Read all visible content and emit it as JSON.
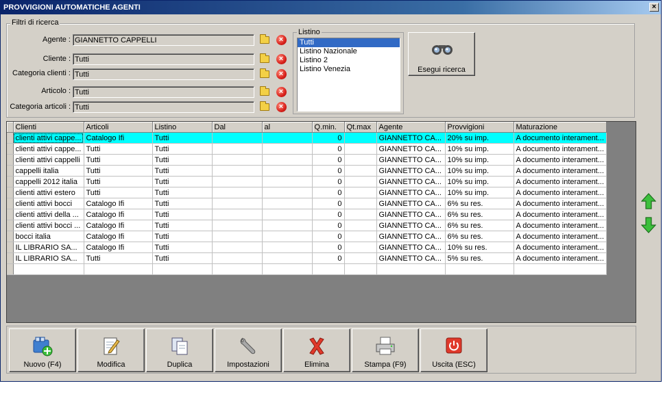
{
  "window": {
    "title": "PROVVIGIONI AUTOMATICHE AGENTI",
    "close": "×"
  },
  "filters": {
    "legend": "Filtri di ricerca",
    "agente_label": "Agente :",
    "agente_value": "GIANNETTO CAPPELLI",
    "cliente_label": "Cliente :",
    "cliente_value": "Tutti",
    "catcli_label": "Categoria clienti :",
    "catcli_value": "Tutti",
    "articolo_label": "Articolo :",
    "articolo_value": "Tutti",
    "catart_label": "Categoria articoli :",
    "catart_value": "Tutti"
  },
  "listino": {
    "legend": "Listino",
    "items": [
      "Tutti",
      "Listino Nazionale",
      "Listino 2",
      "Listino Venezia"
    ],
    "selected": "Tutti"
  },
  "search_button": "Esegui ricerca",
  "grid": {
    "columns": [
      "Clienti",
      "Articoli",
      "Listino",
      "Dal",
      "al",
      "Q.min.",
      "Qt.max",
      "Agente",
      "Provvigioni",
      "Maturazione"
    ],
    "rows": [
      [
        "clienti attivi cappe...",
        "Catalogo Ifi",
        "Tutti",
        "",
        "",
        "0",
        "",
        "GIANNETTO CA...",
        "20% su imp.",
        "A documento interament..."
      ],
      [
        "clienti attivi cappe...",
        "Tutti",
        "Tutti",
        "",
        "",
        "0",
        "",
        "GIANNETTO CA...",
        "10% su imp.",
        "A documento interament..."
      ],
      [
        "clienti attivi cappelli",
        "Tutti",
        "Tutti",
        "",
        "",
        "0",
        "",
        "GIANNETTO CA...",
        "10% su imp.",
        "A documento interament..."
      ],
      [
        "cappelli italia",
        "Tutti",
        "Tutti",
        "",
        "",
        "0",
        "",
        "GIANNETTO CA...",
        "10% su imp.",
        "A documento interament..."
      ],
      [
        "cappelli 2012 italia",
        "Tutti",
        "Tutti",
        "",
        "",
        "0",
        "",
        "GIANNETTO CA...",
        "10% su imp.",
        "A documento interament..."
      ],
      [
        "clienti attivi estero",
        "Tutti",
        "Tutti",
        "",
        "",
        "0",
        "",
        "GIANNETTO CA...",
        "10% su imp.",
        "A documento interament..."
      ],
      [
        "clienti attivi bocci",
        "Catalogo Ifi",
        "Tutti",
        "",
        "",
        "0",
        "",
        "GIANNETTO CA...",
        "6% su res.",
        "A documento interament..."
      ],
      [
        "clienti attivi della ...",
        "Catalogo Ifi",
        "Tutti",
        "",
        "",
        "0",
        "",
        "GIANNETTO CA...",
        "6% su res.",
        "A documento interament..."
      ],
      [
        "clienti attivi bocci ...",
        "Catalogo Ifi",
        "Tutti",
        "",
        "",
        "0",
        "",
        "GIANNETTO CA...",
        "6% su res.",
        "A documento interament..."
      ],
      [
        "bocci italia",
        "Catalogo Ifi",
        "Tutti",
        "",
        "",
        "0",
        "",
        "GIANNETTO CA...",
        "6% su res.",
        "A documento interament..."
      ],
      [
        "IL LIBRARIO SA...",
        "Catalogo Ifi",
        "Tutti",
        "",
        "",
        "0",
        "",
        "GIANNETTO CA...",
        "10% su res.",
        "A documento interament..."
      ],
      [
        "IL LIBRARIO SA...",
        "Tutti",
        "Tutti",
        "",
        "",
        "0",
        "",
        "GIANNETTO CA...",
        "5% su res.",
        "A documento interament..."
      ]
    ],
    "selected_row": 0
  },
  "toolbar": {
    "nuovo": "Nuovo (F4)",
    "modifica": "Modifica",
    "duplica": "Duplica",
    "impostazioni": "Impostazioni",
    "elimina": "Elimina",
    "stampa": "Stampa (F9)",
    "uscita": "Uscita (ESC)"
  },
  "colors": {
    "selected_row": "#00ffff",
    "list_selection": "#316ac5",
    "title_start": "#0a246a",
    "arrow_green": "#2fa82f"
  }
}
